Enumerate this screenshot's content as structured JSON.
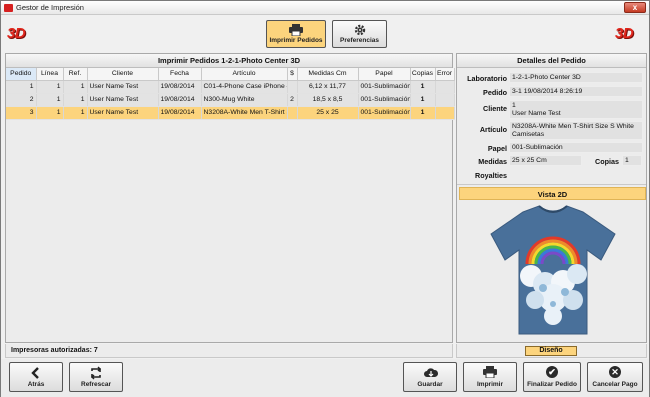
{
  "window": {
    "title": "Gestor de Impresión",
    "close": "x"
  },
  "brand": {
    "logo_text": "3D"
  },
  "toolbar": {
    "print_orders": "Imprimir Pedidos",
    "preferences": "Preferencias"
  },
  "orders": {
    "header": "Imprimir Pedidos 1-2-1-Photo Center 3D",
    "columns": [
      "Pedido",
      "Línea",
      "Ref.",
      "Cliente",
      "Fecha",
      "Artículo",
      "$",
      "Medidas Cm",
      "Papel",
      "Copias",
      "Error"
    ],
    "rows": [
      {
        "pedido": "1",
        "linea": "1",
        "ref": "1",
        "cliente": "User Name Test",
        "fecha": "19/08/2014",
        "articulo": "C01-4-Phone Case iPhone 4",
        "dollar": "",
        "medidas": "6,12 x 11,77",
        "papel": "001-Sublimación",
        "copias": "1",
        "error": ""
      },
      {
        "pedido": "2",
        "linea": "1",
        "ref": "1",
        "cliente": "User Name Test",
        "fecha": "19/08/2014",
        "articulo": "N300-Mug White",
        "dollar": "2",
        "medidas": "18,5 x 8,5",
        "papel": "001-Sublimación",
        "copias": "1",
        "error": ""
      },
      {
        "pedido": "3",
        "linea": "1",
        "ref": "1",
        "cliente": "User Name Test",
        "fecha": "19/08/2014",
        "articulo": "N3208A-White Men T-Shirt S",
        "dollar": "",
        "medidas": "25 x 25",
        "papel": "001-Sublimación",
        "copias": "1",
        "error": ""
      }
    ],
    "selected_row": 2
  },
  "details": {
    "header": "Detalles del Pedido",
    "laboratorio_label": "Laboratorio",
    "laboratorio": "1-2-1-Photo Center 3D",
    "pedido_label": "Pedido",
    "pedido": "3-1  19/08/2014 8:26:19",
    "cliente_label": "Cliente",
    "cliente_id": "1",
    "cliente_name": "User Name Test",
    "articulo_label": "Artículo",
    "articulo_1": "N3208A-White Men T-Shirt Size S White",
    "articulo_2": "Camisetas",
    "papel_label": "Papel",
    "papel": "001-Sublimación",
    "medidas_label": "Medidas",
    "medidas": "25 x 25 Cm",
    "copias_label": "Copias",
    "copias": "1",
    "royalties_label": "Royalties"
  },
  "preview": {
    "header": "Vista 2D",
    "design_button": "Diseño"
  },
  "status": {
    "authorized_printers": "Impresoras autorizadas: 7"
  },
  "bottom": {
    "back": "Atrás",
    "refresh": "Refrescar",
    "save": "Guardar",
    "print": "Imprimir",
    "finish": "Finalizar Pedido",
    "cancel": "Cancelar Pago"
  },
  "colors": {
    "selected": "#fcd47d",
    "brand_red": "#e0261c",
    "button_active": "#fcd47d"
  }
}
